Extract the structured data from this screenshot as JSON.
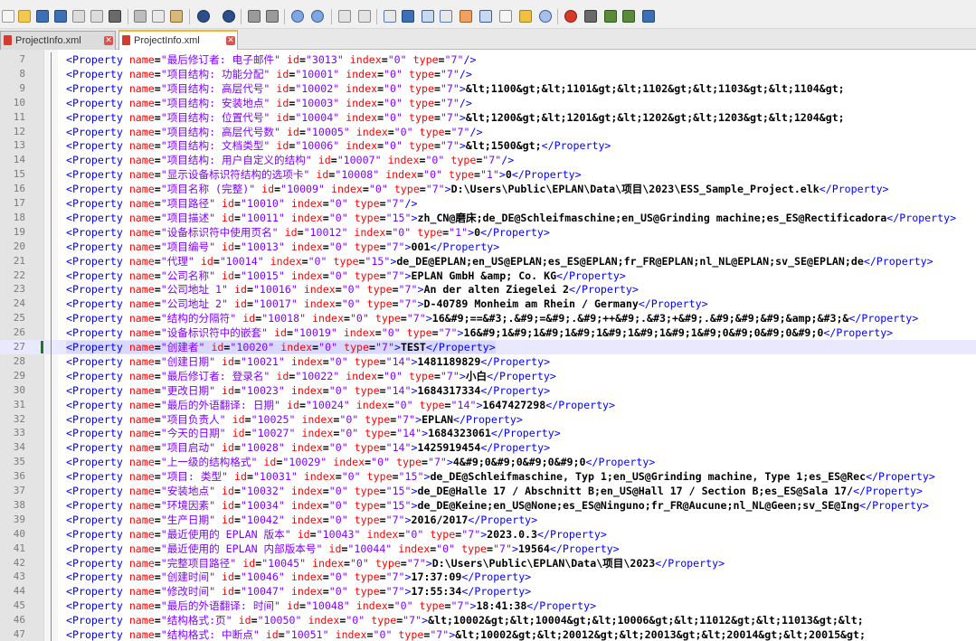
{
  "tabs": [
    {
      "label": "ProjectInfo.xml",
      "active": false
    },
    {
      "label": "ProjectInfo.xml",
      "active": true
    }
  ],
  "editor": {
    "current_line": 27,
    "lines": [
      {
        "n": 7,
        "name": "最后修订者: 电子邮件",
        "id": "3013",
        "index": "0",
        "type": "7",
        "content": null
      },
      {
        "n": 8,
        "name": "项目结构: 功能分配",
        "id": "10001",
        "index": "0",
        "type": "7",
        "content": null
      },
      {
        "n": 9,
        "name": "项目结构: 高层代号",
        "id": "10002",
        "index": "0",
        "type": "7",
        "content": "&lt;1100&gt;&lt;1101&gt;&lt;1102&gt;&lt;1103&gt;&lt;1104&gt;"
      },
      {
        "n": 10,
        "name": "项目结构: 安装地点",
        "id": "10003",
        "index": "0",
        "type": "7",
        "content": null
      },
      {
        "n": 11,
        "name": "项目结构: 位置代号",
        "id": "10004",
        "index": "0",
        "type": "7",
        "content": "&lt;1200&gt;&lt;1201&gt;&lt;1202&gt;&lt;1203&gt;&lt;1204&gt;"
      },
      {
        "n": 12,
        "name": "项目结构: 高层代号数",
        "id": "10005",
        "index": "0",
        "type": "7",
        "content": null
      },
      {
        "n": 13,
        "name": "项目结构: 文档类型",
        "id": "10006",
        "index": "0",
        "type": "7",
        "content": "&lt;1500&gt;",
        "close": true
      },
      {
        "n": 14,
        "name": "项目结构: 用户自定义的结构",
        "id": "10007",
        "index": "0",
        "type": "7",
        "content": null
      },
      {
        "n": 15,
        "name": "显示设备标识符结构的选项卡",
        "id": "10008",
        "index": "0",
        "type": "1",
        "content": "0",
        "close": true
      },
      {
        "n": 16,
        "name": "项目名称 (完整)",
        "id": "10009",
        "index": "0",
        "type": "7",
        "content": "D:\\Users\\Public\\EPLAN\\Data\\项目\\2023\\ESS_Sample_Project.elk",
        "close": true
      },
      {
        "n": 17,
        "name": "项目路径",
        "id": "10010",
        "index": "0",
        "type": "7",
        "content": null
      },
      {
        "n": 18,
        "name": "项目描述",
        "id": "10011",
        "index": "0",
        "type": "15",
        "content": "zh_CN@磨床;de_DE@Schleifmaschine;en_US@Grinding machine;es_ES@Rectificadora",
        "close": true
      },
      {
        "n": 19,
        "name": "设备标识符中使用页名",
        "id": "10012",
        "index": "0",
        "type": "1",
        "content": "0",
        "close": true
      },
      {
        "n": 20,
        "name": "项目编号",
        "id": "10013",
        "index": "0",
        "type": "7",
        "content": "001",
        "close": true
      },
      {
        "n": 21,
        "name": "代理",
        "id": "10014",
        "index": "0",
        "type": "15",
        "content": "de_DE@EPLAN;en_US@EPLAN;es_ES@EPLAN;fr_FR@EPLAN;nl_NL@EPLAN;sv_SE@EPLAN;de",
        "close": true
      },
      {
        "n": 22,
        "name": "公司名称",
        "id": "10015",
        "index": "0",
        "type": "7",
        "content": "EPLAN GmbH &amp; Co. KG",
        "close": true
      },
      {
        "n": 23,
        "name": "公司地址 1",
        "id": "10016",
        "index": "0",
        "type": "7",
        "content": "An der alten Ziegelei 2",
        "close": true
      },
      {
        "n": 24,
        "name": "公司地址 2",
        "id": "10017",
        "index": "0",
        "type": "7",
        "content": "D-40789 Monheim am Rhein / Germany",
        "close": true
      },
      {
        "n": 25,
        "name": "结构的分隔符",
        "id": "10018",
        "index": "0",
        "type": "7",
        "content": "16&#9;==&#3;.&#9;=&#9;.&#9;++&#9;.&#3;+&#9;.&#9;&#9;&#9;&amp;&#3;&",
        "close": true
      },
      {
        "n": 26,
        "name": "设备标识符中的嵌套",
        "id": "10019",
        "index": "0",
        "type": "7",
        "content": "16&#9;1&#9;1&#9;1&#9;1&#9;1&#9;1&#9;1&#9;0&#9;0&#9;0&#9;0",
        "close": true
      },
      {
        "n": 27,
        "name": "创建者",
        "id": "10020",
        "index": "0",
        "type": "7",
        "content": "TEST",
        "close": true
      },
      {
        "n": 28,
        "name": "创建日期",
        "id": "10021",
        "index": "0",
        "type": "14",
        "content": "1481189829",
        "close": true
      },
      {
        "n": 29,
        "name": "最后修订者: 登录名",
        "id": "10022",
        "index": "0",
        "type": "7",
        "content": "小白",
        "close": true
      },
      {
        "n": 30,
        "name": "更改日期",
        "id": "10023",
        "index": "0",
        "type": "14",
        "content": "1684317334",
        "close": true
      },
      {
        "n": 31,
        "name": "最后的外语翻译: 日期",
        "id": "10024",
        "index": "0",
        "type": "14",
        "content": "1647427298",
        "close": true
      },
      {
        "n": 32,
        "name": "项目负责人",
        "id": "10025",
        "index": "0",
        "type": "7",
        "content": "EPLAN",
        "close": true
      },
      {
        "n": 33,
        "name": "今天的日期",
        "id": "10027",
        "index": "0",
        "type": "14",
        "content": "1684323061",
        "close": true
      },
      {
        "n": 34,
        "name": "项目启动",
        "id": "10028",
        "index": "0",
        "type": "14",
        "content": "1425919454",
        "close": true
      },
      {
        "n": 35,
        "name": "上一级的结构格式",
        "id": "10029",
        "index": "0",
        "type": "7",
        "content": "4&#9;0&#9;0&#9;0&#9;0",
        "close": true
      },
      {
        "n": 36,
        "name": "项目: 类型",
        "id": "10031",
        "index": "0",
        "type": "15",
        "content": "de_DE@Schleifmaschine, Typ 1;en_US@Grinding machine, Type 1;es_ES@Rec",
        "close": true
      },
      {
        "n": 37,
        "name": "安装地点",
        "id": "10032",
        "index": "0",
        "type": "15",
        "content": "de_DE@Halle 17 / Abschnitt B;en_US@Hall 17 / Section B;es_ES@Sala 17/",
        "close": true
      },
      {
        "n": 38,
        "name": "环境因素",
        "id": "10034",
        "index": "0",
        "type": "15",
        "content": "de_DE@Keine;en_US@None;es_ES@Ninguno;fr_FR@Aucune;nl_NL@Geen;sv_SE@Ing",
        "close": true
      },
      {
        "n": 39,
        "name": "生产日期",
        "id": "10042",
        "index": "0",
        "type": "7",
        "content": "2016/2017",
        "close": true
      },
      {
        "n": 40,
        "name": "最近使用的 EPLAN 版本",
        "id": "10043",
        "index": "0",
        "type": "7",
        "content": "2023.0.3",
        "close": true
      },
      {
        "n": 41,
        "name": "最近使用的 EPLAN 内部版本号",
        "id": "10044",
        "index": "0",
        "type": "7",
        "content": "19564",
        "close": true
      },
      {
        "n": 42,
        "name": "完整项目路径",
        "id": "10045",
        "index": "0",
        "type": "7",
        "content": "D:\\Users\\Public\\EPLAN\\Data\\项目\\2023",
        "close": true
      },
      {
        "n": 43,
        "name": "创建时间",
        "id": "10046",
        "index": "0",
        "type": "7",
        "content": "17:37:09",
        "close": true
      },
      {
        "n": 44,
        "name": "修改时间",
        "id": "10047",
        "index": "0",
        "type": "7",
        "content": "17:55:34",
        "close": true
      },
      {
        "n": 45,
        "name": "最后的外语翻译: 时间",
        "id": "10048",
        "index": "0",
        "type": "7",
        "content": "18:41:38",
        "close": true
      },
      {
        "n": 46,
        "name": "结构格式:页",
        "id": "10050",
        "index": "0",
        "type": "7",
        "content": "&lt;10002&gt;&lt;10004&gt;&lt;10006&gt;&lt;11012&gt;&lt;11013&gt;&lt;",
        "close": false
      },
      {
        "n": 47,
        "name": "结构格式: 中断点",
        "id": "10051",
        "index": "0",
        "type": "7",
        "content": "&lt;10002&gt;&lt;20012&gt;&lt;20013&gt;&lt;20014&gt;&lt;20015&gt;",
        "close": false
      }
    ]
  },
  "colors": {
    "tag": "#0000ff",
    "attr_name": "#ff0000",
    "attr_value": "#8000ff",
    "text": "#000000",
    "current_line": "#e8e8ff",
    "tab_accent": "#f6b52a"
  }
}
